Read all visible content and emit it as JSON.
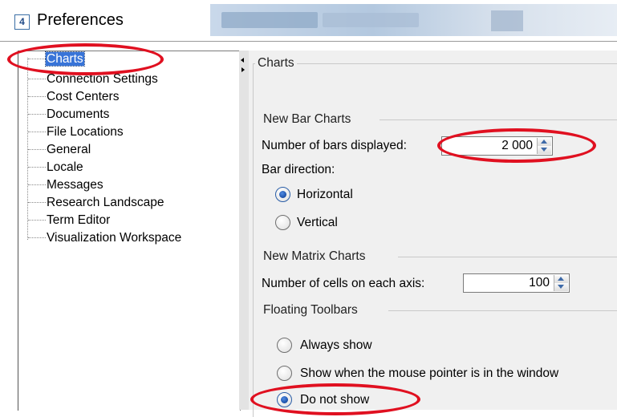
{
  "window": {
    "title": "Preferences",
    "icon": "app-icon",
    "icon_glyph": "4"
  },
  "tree": {
    "items": [
      {
        "label": "Charts",
        "selected": true
      },
      {
        "label": "Connection Settings"
      },
      {
        "label": "Cost Centers"
      },
      {
        "label": "Documents"
      },
      {
        "label": "File Locations"
      },
      {
        "label": "General"
      },
      {
        "label": "Locale"
      },
      {
        "label": "Messages"
      },
      {
        "label": "Research Landscape"
      },
      {
        "label": "Term Editor"
      },
      {
        "label": "Visualization Workspace"
      }
    ]
  },
  "panel": {
    "title": "Charts",
    "bar_charts": {
      "group_title": "New Bar Charts",
      "bars_label": "Number of bars displayed:",
      "bars_value": "2 000",
      "direction_label": "Bar direction:",
      "horizontal_label": "Horizontal",
      "vertical_label": "Vertical",
      "selected": "Horizontal"
    },
    "matrix_charts": {
      "group_title": "New Matrix Charts",
      "cells_label": "Number of cells on each axis:",
      "cells_value": "100"
    },
    "floating_toolbars": {
      "group_title": "Floating Toolbars",
      "always_label": "Always show",
      "mouse_label": "Show when the mouse pointer is in the window",
      "never_label": "Do not show",
      "selected": "Do not show"
    }
  },
  "colors": {
    "selection": "#3874d8",
    "annotation": "#e01020",
    "panel_bg": "#f0f0f0"
  }
}
